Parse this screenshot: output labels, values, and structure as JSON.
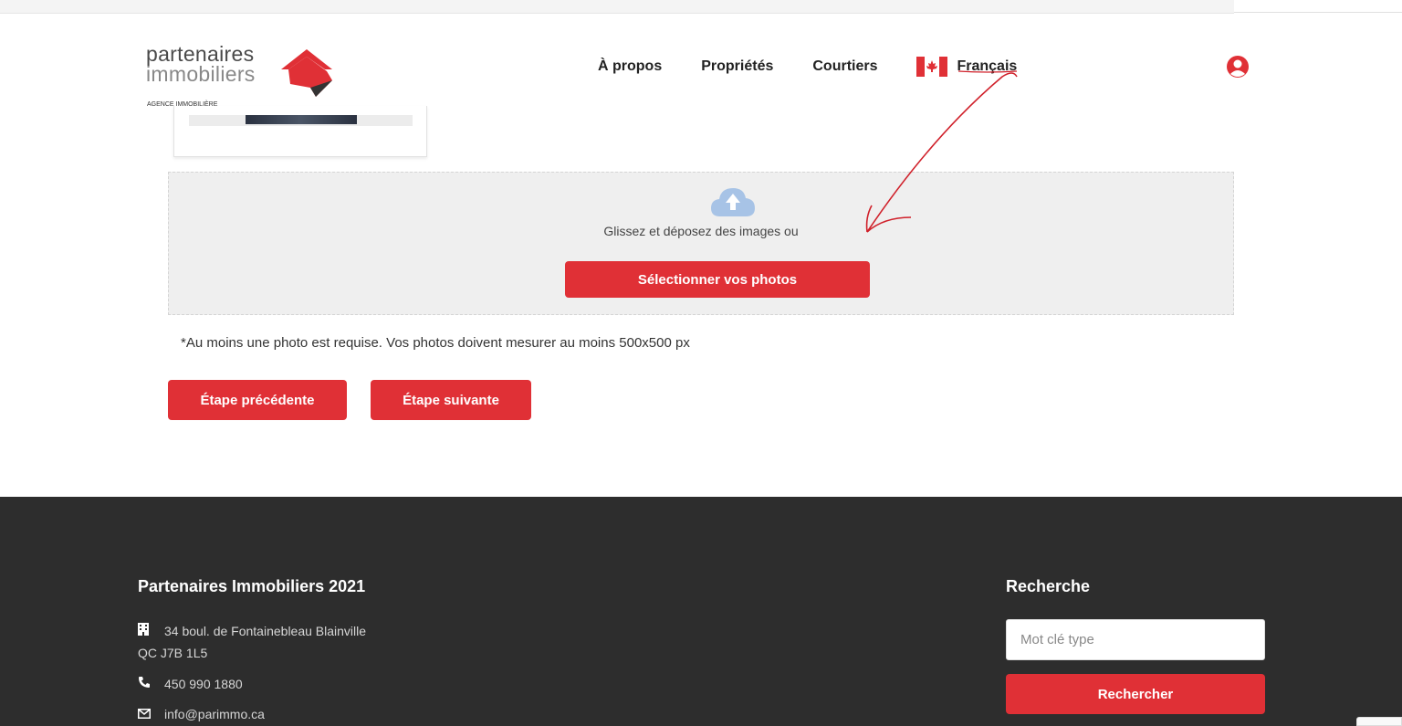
{
  "header": {
    "logo": {
      "line1": "partenaires",
      "line2": "immobiliers",
      "tagline": "AGENCE IMMOBILIÈRE"
    },
    "nav": [
      "À propos",
      "Propriétés",
      "Courtiers"
    ],
    "language": "Français"
  },
  "upload": {
    "dropzone_text": "Glissez et déposez des images ou",
    "select_button": "Sélectionner vos photos",
    "note": "*Au moins une photo est requise. Vos photos doivent mesurer au moins 500x500 px"
  },
  "steps": {
    "previous": "Étape précédente",
    "next": "Étape suivante"
  },
  "footer": {
    "company_title": "Partenaires Immobiliers 2021",
    "address_line1": "34 boul. de Fontainebleau Blainville",
    "address_line2": "QC J7B 1L5",
    "phone": "450 990 1880",
    "email": "info@parimmo.ca",
    "search_title": "Recherche",
    "search_placeholder": "Mot clé type",
    "search_button": "Rechercher"
  },
  "colors": {
    "accent": "#e03036",
    "footer_bg": "#2d2d2d",
    "annotation": "#d0202a"
  }
}
